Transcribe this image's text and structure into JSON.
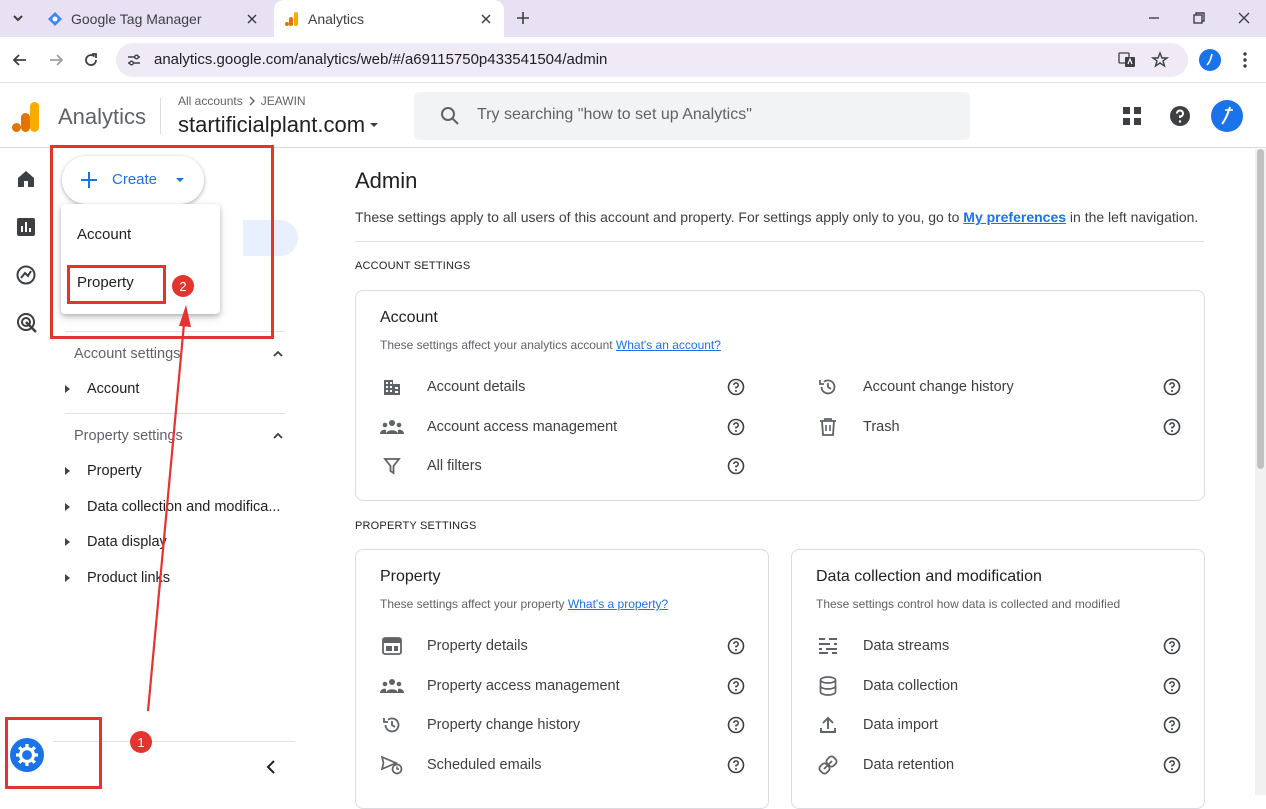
{
  "browser": {
    "tabs": [
      {
        "title": "Google Tag Manager"
      },
      {
        "title": "Analytics"
      }
    ],
    "url": "analytics.google.com/analytics/web/#/a69115750p433541504/admin"
  },
  "header": {
    "product": "Analytics",
    "breadcrumb_root": "All accounts",
    "breadcrumb_account": "JEAWIN",
    "property_name": "startificialplant.com",
    "search_placeholder": "Try searching \"how to set up Analytics\""
  },
  "create": {
    "label": "Create",
    "menu": [
      "Account",
      "Property"
    ]
  },
  "nav": {
    "account_settings": "Account settings",
    "account_items": [
      "Account"
    ],
    "property_settings": "Property settings",
    "property_items": [
      "Property",
      "Data collection and modifica...",
      "Data display",
      "Product links"
    ]
  },
  "admin": {
    "title": "Admin",
    "desc_before": "These settings apply to all users of this account and property. For settings apply only to you, go to ",
    "desc_link": "My preferences",
    "desc_after": " in the left navigation.",
    "account_section": "ACCOUNT SETTINGS",
    "property_section": "PROPERTY SETTINGS"
  },
  "account_card": {
    "title": "Account",
    "subtitle": "These settings affect your analytics account",
    "subtitle_link": "What's an account?",
    "left": [
      "Account details",
      "Account access management",
      "All filters"
    ],
    "right": [
      "Account change history",
      "Trash"
    ]
  },
  "property_card": {
    "title": "Property",
    "subtitle": "These settings affect your property",
    "subtitle_link": "What's a property?",
    "items": [
      "Property details",
      "Property access management",
      "Property change history",
      "Scheduled emails"
    ]
  },
  "data_card": {
    "title": "Data collection and modification",
    "subtitle": "These settings control how data is collected and modified",
    "items": [
      "Data streams",
      "Data collection",
      "Data import",
      "Data retention"
    ]
  },
  "annotations": {
    "badge1": "1",
    "badge2": "2"
  },
  "colors": {
    "accent": "#1a73e8",
    "annotation": "#e3342f",
    "logo_orange": "#f9ab00",
    "logo_dark": "#e37400"
  }
}
